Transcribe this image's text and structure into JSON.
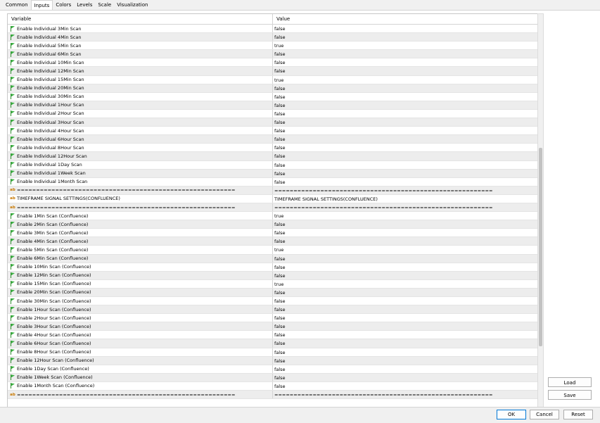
{
  "tabs": [
    "Common",
    "Inputs",
    "Colors",
    "Levels",
    "Scale",
    "Visualization"
  ],
  "active_tab": "Inputs",
  "columns": {
    "variable": "Variable",
    "value": "Value"
  },
  "rows": [
    {
      "icon": "flag",
      "variable": "Enable Individual 3Min Scan",
      "value": "false"
    },
    {
      "icon": "flag",
      "variable": "Enable Individual 4Min Scan",
      "value": "false"
    },
    {
      "icon": "flag",
      "variable": "Enable Individual 5Min Scan",
      "value": "true"
    },
    {
      "icon": "flag",
      "variable": "Enable Individual 6Min Scan",
      "value": "false"
    },
    {
      "icon": "flag",
      "variable": "Enable Individual 10Min Scan",
      "value": "false"
    },
    {
      "icon": "flag",
      "variable": "Enable Individual 12Min Scan",
      "value": "false"
    },
    {
      "icon": "flag",
      "variable": "Enable Individual 15Min Scan",
      "value": "true"
    },
    {
      "icon": "flag",
      "variable": "Enable Individual 20Min Scan",
      "value": "false"
    },
    {
      "icon": "flag",
      "variable": "Enable Individual 30Min Scan",
      "value": "false"
    },
    {
      "icon": "flag",
      "variable": "Enable Individual 1Hour Scan",
      "value": "false"
    },
    {
      "icon": "flag",
      "variable": "Enable Individual 2Hour Scan",
      "value": "false"
    },
    {
      "icon": "flag",
      "variable": "Enable Individual 3Hour Scan",
      "value": "false"
    },
    {
      "icon": "flag",
      "variable": "Enable Individual 4Hour Scan",
      "value": "false"
    },
    {
      "icon": "flag",
      "variable": "Enable Individual 6Hour Scan",
      "value": "false"
    },
    {
      "icon": "flag",
      "variable": "Enable Individual 8Hour Scan",
      "value": "false"
    },
    {
      "icon": "flag",
      "variable": "Enable Individual 12Hour Scan",
      "value": "false"
    },
    {
      "icon": "flag",
      "variable": "Enable Individual 1Day Scan",
      "value": "false"
    },
    {
      "icon": "flag",
      "variable": "Enable Individual 1Week Scan",
      "value": "false"
    },
    {
      "icon": "flag",
      "variable": "Enable Individual 1Month Scan",
      "value": "false"
    },
    {
      "icon": "ab",
      "variable": "=========================================================",
      "value": "========================================================="
    },
    {
      "icon": "ab",
      "variable": "TIMEFRAME SIGNAL SETTINGS(CONFLUENCE)",
      "value": "TIMEFRAME SIGNAL SETTINGS(CONFLUENCE)"
    },
    {
      "icon": "ab",
      "variable": "=========================================================",
      "value": "========================================================="
    },
    {
      "icon": "flag",
      "variable": "Enable 1Min Scan (Confluence)",
      "value": "true"
    },
    {
      "icon": "flag",
      "variable": "Enable 2Min Scan (Confluence)",
      "value": "false"
    },
    {
      "icon": "flag",
      "variable": "Enable 3Min Scan (Confluence)",
      "value": "false"
    },
    {
      "icon": "flag",
      "variable": "Enable 4Min Scan (Confluence)",
      "value": "false"
    },
    {
      "icon": "flag",
      "variable": "Enable 5Min Scan (Confluence)",
      "value": "true"
    },
    {
      "icon": "flag",
      "variable": "Enable 6Min Scan (Confluence)",
      "value": "false"
    },
    {
      "icon": "flag",
      "variable": "Enable 10Min Scan (Confluence)",
      "value": "false"
    },
    {
      "icon": "flag",
      "variable": "Enable 12Min Scan (Confluence)",
      "value": "false"
    },
    {
      "icon": "flag",
      "variable": "Enable 15Min Scan (Confluence)",
      "value": "true"
    },
    {
      "icon": "flag",
      "variable": "Enable 20Min Scan (Confluence)",
      "value": "false"
    },
    {
      "icon": "flag",
      "variable": "Enable 30Min Scan (Confluence)",
      "value": "false"
    },
    {
      "icon": "flag",
      "variable": "Enable 1Hour Scan (Confluence)",
      "value": "false"
    },
    {
      "icon": "flag",
      "variable": "Enable 2Hour Scan (Confluence)",
      "value": "false"
    },
    {
      "icon": "flag",
      "variable": "Enable 3Hour Scan (Confluence)",
      "value": "false"
    },
    {
      "icon": "flag",
      "variable": "Enable 4Hour Scan (Confluence)",
      "value": "false"
    },
    {
      "icon": "flag",
      "variable": "Enable 6Hour Scan (Confluence)",
      "value": "false"
    },
    {
      "icon": "flag",
      "variable": "Enable 8Hour Scan (Confluence)",
      "value": "false"
    },
    {
      "icon": "flag",
      "variable": "Enable 12Hour Scan (Confluence)",
      "value": "false"
    },
    {
      "icon": "flag",
      "variable": "Enable 1Day Scan (Confluence)",
      "value": "false"
    },
    {
      "icon": "flag",
      "variable": "Enable 1Week Scan (Confluence)",
      "value": "false"
    },
    {
      "icon": "flag",
      "variable": "Enable 1Month Scan (Confluence)",
      "value": "false"
    },
    {
      "icon": "ab",
      "variable": "=========================================================",
      "value": "========================================================="
    }
  ],
  "buttons": {
    "load": "Load",
    "save": "Save",
    "ok": "OK",
    "cancel": "Cancel",
    "reset": "Reset"
  },
  "colors": {
    "flag_icon": "#3cb043",
    "ab_icon": "#c87800",
    "primary_border": "#0078d7"
  }
}
